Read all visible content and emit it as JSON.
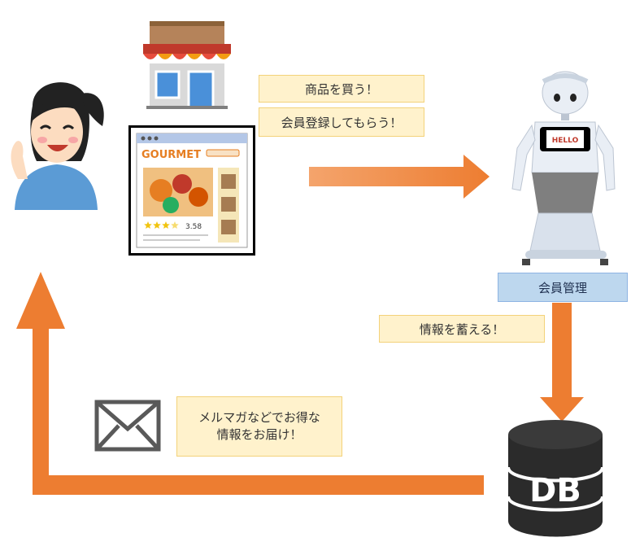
{
  "labels": {
    "buy": "商品を買う！",
    "register": "会員登録してもらう！",
    "member_management": "会員管理",
    "store_info": "情報を蓄える！",
    "deliver_line1": "メルマガなどでお得な",
    "deliver_line2": "情報をお届け！"
  },
  "website": {
    "brand": "GOURMET",
    "rating": "3.58",
    "star_count": 3.5
  },
  "robot": {
    "screen_text": "HELLO"
  },
  "database": {
    "text": "DB"
  },
  "colors": {
    "arrow": "#ed7d31",
    "label_bg": "#fff2cc",
    "management_bg": "#bdd7ee"
  },
  "icons": [
    "woman-icon",
    "shop-icon",
    "website-icon",
    "robot-icon",
    "database-icon",
    "mail-icon"
  ]
}
